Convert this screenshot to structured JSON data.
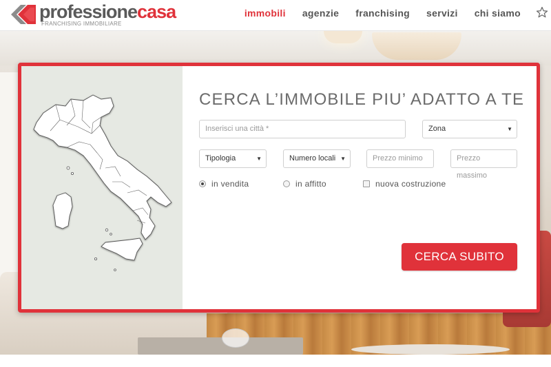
{
  "header": {
    "logo_text_part1": "professione",
    "logo_text_part2": "casa",
    "logo_subtitle": "FRANCHISING IMMOBILIARE",
    "nav": [
      {
        "label": "immobili",
        "active": true
      },
      {
        "label": "agenzie",
        "active": false
      },
      {
        "label": "franchising",
        "active": false
      },
      {
        "label": "servizi",
        "active": false
      },
      {
        "label": "chi siamo",
        "active": false
      }
    ],
    "star_icon": "star-icon"
  },
  "search": {
    "title": "CERCA L’IMMOBILE PIU’ ADATTO A TE",
    "city_placeholder": "Inserisci una città *",
    "zona_value": "Zona",
    "tipologia_value": "Tipologia",
    "locali_value": "Numero locali",
    "prezzo_min_placeholder": "Prezzo minimo",
    "prezzo_max_placeholder": "Prezzo massimo",
    "options": {
      "vendita": {
        "label": "in vendita",
        "selected": true
      },
      "affitto": {
        "label": "in affitto",
        "selected": false
      },
      "nuova": {
        "label": "nuova costruzione",
        "checked": false
      }
    },
    "button_label": "CERCA SUBITO"
  },
  "map": {
    "icon": "italy-map-icon"
  },
  "colors": {
    "brand_red": "#e0323a",
    "brand_gray": "#5a5a5a",
    "map_bg": "#e6e9e3"
  }
}
